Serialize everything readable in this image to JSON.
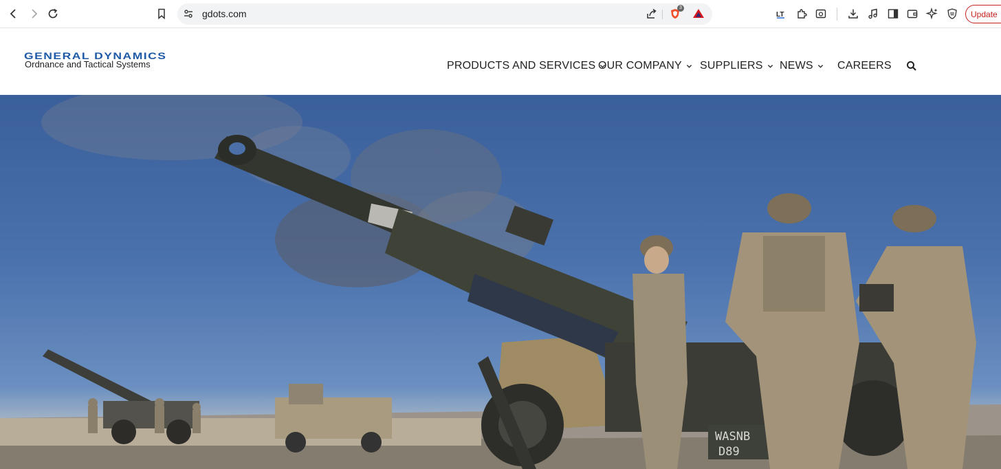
{
  "browser": {
    "url": "gdots.com",
    "update_label": "Update",
    "icons": [
      "back-icon",
      "forward-icon",
      "reload-icon",
      "bookmark-icon",
      "site-settings-icon",
      "share-icon",
      "brave-shields-icon",
      "brave-rewards-icon",
      "extension-lt-icon",
      "extensions-icon",
      "screenshot-icon",
      "downloads-icon",
      "media-icon",
      "sidebar-icon",
      "wallet-icon",
      "leo-ai-icon",
      "vpn-icon"
    ],
    "shields_count": "3"
  },
  "site": {
    "logo_main": "GENERAL DYNAMICS",
    "logo_sub": "Ordnance and Tactical Systems",
    "nav": [
      {
        "label": "PRODUCTS AND SERVICES",
        "has_dropdown": true
      },
      {
        "label": "OUR COMPANY",
        "has_dropdown": true
      },
      {
        "label": "SUPPLIERS",
        "has_dropdown": true
      },
      {
        "label": "NEWS",
        "has_dropdown": true
      },
      {
        "label": "CAREERS",
        "has_dropdown": false
      }
    ],
    "search_icon": "search-icon"
  },
  "hero": {
    "vehicle_marking_1": "WASNB",
    "vehicle_marking_2": "D89"
  },
  "colors": {
    "brand_blue": "#1f5aa6",
    "update_red": "#c5221f",
    "sky": "#4b72ad"
  }
}
